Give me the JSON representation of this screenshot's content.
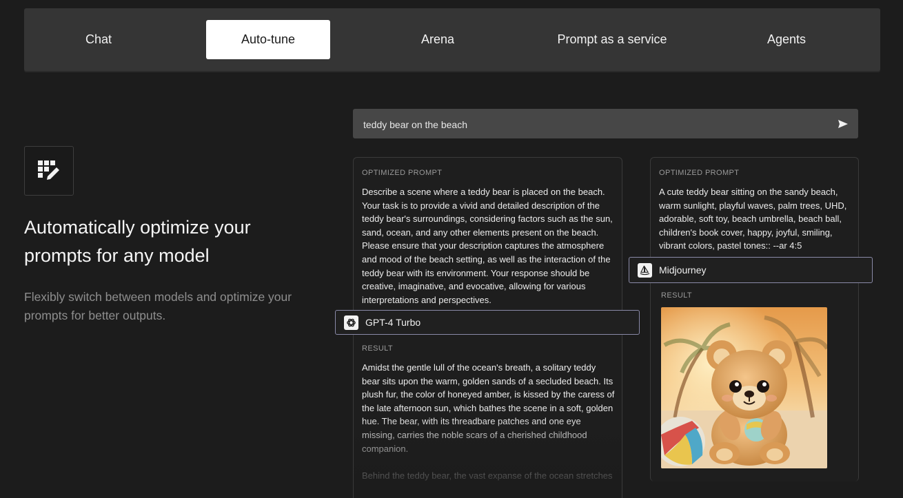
{
  "tabs": [
    {
      "label": "Chat",
      "active": false
    },
    {
      "label": "Auto-tune",
      "active": true
    },
    {
      "label": "Arena",
      "active": false
    },
    {
      "label": "Prompt as a service",
      "active": false
    },
    {
      "label": "Agents",
      "active": false
    }
  ],
  "hero": {
    "icon": "grid-edit-icon",
    "title": "Automatically optimize your prompts for any model",
    "subtitle": "Flexibly switch between models and optimize your prompts for better outputs."
  },
  "search": {
    "value": "teddy bear on the beach",
    "send_icon": "send-icon"
  },
  "cards": {
    "gpt": {
      "optimized_label": "OPTIMIZED PROMPT",
      "optimized_text": "Describe a scene where a teddy bear is placed on the beach. Your task is to provide a vivid and detailed description of the teddy bear's surroundings, considering factors such as the sun, sand, ocean, and any other elements present on the beach. Please ensure that your description captures the atmosphere and mood of the beach setting, as well as the interaction of the teddy bear with its environment. Your response should be creative, imaginative, and evocative, allowing for various interpretations and perspectives.",
      "model_name": "GPT-4 Turbo",
      "model_icon": "openai-logo-icon",
      "result_label": "RESULT",
      "result_text": "Amidst the gentle lull of the ocean's breath, a solitary teddy bear sits upon the warm, golden sands of a secluded beach. Its plush fur, the color of honeyed amber, is kissed by the caress of the late afternoon sun, which bathes the scene in a soft, golden hue. The bear, with its threadbare patches and one eye missing, carries the noble scars of a cherished childhood companion.",
      "result_text_2": "Behind the teddy bear, the vast expanse of the ocean stretches"
    },
    "midjourney": {
      "optimized_label": "OPTIMIZED PROMPT",
      "optimized_text": "A cute teddy bear sitting on the sandy beach, warm sunlight, playful waves, palm trees, UHD, adorable, soft toy, beach umbrella, beach ball, children's book cover, happy, joyful, smiling, vibrant colors, pastel tones:: --ar 4:5",
      "model_name": "Midjourney",
      "model_icon": "midjourney-sailboat-icon",
      "result_label": "RESULT",
      "result_image": "teddy-bear-beach-image"
    }
  },
  "colors": {
    "background": "#1c1c1c",
    "tabbar": "#353535",
    "active_tab": "#ffffff",
    "pill_border": "#8a8aa8"
  }
}
